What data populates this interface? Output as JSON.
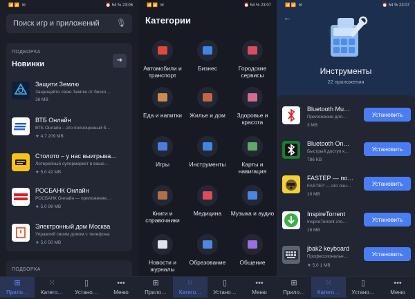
{
  "status": {
    "p1": {
      "left": "📶📶 ✉",
      "right": "⏰ 54 % 23:06"
    },
    "p2": {
      "left": "📶📶 ✉",
      "right": "⏰ 54 % 23:07"
    },
    "p3": {
      "left": "📶📶 ✉",
      "right": "⏰ 54 % 23:07"
    }
  },
  "nav": {
    "apps": "Прило…",
    "categories": "Катего…",
    "installed": "Устано…",
    "menu": "Меню"
  },
  "home": {
    "search_placeholder": "Поиск игр и приложений",
    "section_kicker": "ПОДБОРКА",
    "section_title": "Новинки",
    "next_section_kicker": "ПОДБОРКА",
    "apps": [
      {
        "name": "Защити Землю",
        "desc": "Защищайте свою Землю от беско…",
        "meta": "36 MB",
        "rating": ""
      },
      {
        "name": "ВТБ Онлайн",
        "desc": "ВТБ Онлайн – это полноценный б…",
        "meta": "4,7  209 MB",
        "rating": "★"
      },
      {
        "name": "Столото – у нас выигрыва…",
        "desc": "Лотерейный супермаркет в ваше…",
        "meta": "5,0  42 MB",
        "rating": "★"
      },
      {
        "name": "РОСБАНК Онлайн",
        "desc": "РОСБАНК Онлайн — приложение…",
        "meta": "5,0  99 MB",
        "rating": "★"
      },
      {
        "name": "Электронный дом Москва",
        "desc": "Управляй своим домом с телефона",
        "meta": "5,0  50 MB",
        "rating": "★"
      }
    ]
  },
  "categories": {
    "title": "Категории",
    "items": [
      {
        "label": "Автомобили и транспорт",
        "color": "#e0483c"
      },
      {
        "label": "Бизнес",
        "color": "#3e86e6"
      },
      {
        "label": "Городские сервисы",
        "color": "#d8505e"
      },
      {
        "label": "Еда и напитки",
        "color": "#c98d4f"
      },
      {
        "label": "Жилье и дом",
        "color": "#c0674a"
      },
      {
        "label": "Здоровье и красота",
        "color": "#d96a8f"
      },
      {
        "label": "Игры",
        "color": "#4a7de0"
      },
      {
        "label": "Инструменты",
        "color": "#3f86e6"
      },
      {
        "label": "Карты и навигация",
        "color": "#5daa6a"
      },
      {
        "label": "Книги и справочники",
        "color": "#b36f4a"
      },
      {
        "label": "Медицина",
        "color": "#e04b5a"
      },
      {
        "label": "Музыка и аудио",
        "color": "#4a86e0"
      },
      {
        "label": "Новости и журналы",
        "color": "#dfe3ea"
      },
      {
        "label": "Образование",
        "color": "#4d88e6"
      },
      {
        "label": "Общение",
        "color": "#9d6ee0"
      }
    ]
  },
  "tools": {
    "back_icon": "←",
    "title": "Инструменты",
    "subtitle": "22 приложения",
    "install_label": "Установить",
    "apps": [
      {
        "name": "Bluetooth Mu…",
        "desc": "Приложение для…",
        "meta": "3 MB",
        "rating": ""
      },
      {
        "name": "Bluetooth On…",
        "desc": "Быстрый доступ к…",
        "meta": "786 KB",
        "rating": ""
      },
      {
        "name": "FASTEP — по…",
        "desc": "FASTEP — это пон…",
        "meta": "10 MB",
        "rating": ""
      },
      {
        "name": "InspireTorrent",
        "desc": "InspireTorrent это…",
        "meta": "18 MB",
        "rating": ""
      },
      {
        "name": "jbak2 keyboard",
        "desc": "Профессиональн…",
        "meta": "5,0  1 MB",
        "rating": "★"
      }
    ]
  }
}
